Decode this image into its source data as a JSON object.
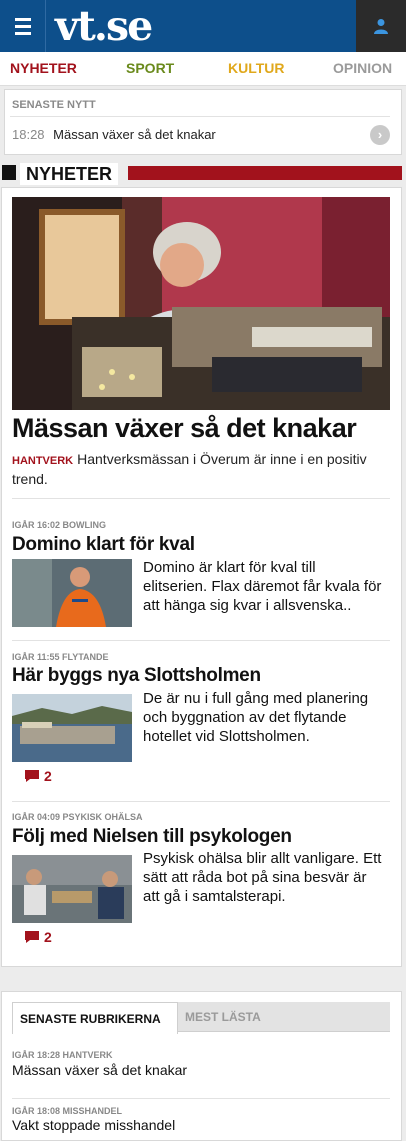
{
  "header": {
    "logo": "vt.se",
    "menu_icon": "hamburger-icon",
    "user_icon": "user-icon",
    "brand_color": "#0d4f8b"
  },
  "nav": {
    "items": [
      {
        "label": "NYHETER",
        "color": "#a2121c"
      },
      {
        "label": "SPORT",
        "color": "#6a8a1c"
      },
      {
        "label": "KULTUR",
        "color": "#e0a81c"
      },
      {
        "label": "OPINION",
        "color": "#9a9a9a"
      }
    ]
  },
  "senaste": {
    "title": "SENASTE NYTT",
    "time": "18:28",
    "text": "Mässan växer så det knakar",
    "arrow": "›"
  },
  "section": {
    "label": "NYHETER",
    "accent": "#a2121c"
  },
  "hero": {
    "headline": "Mässan växer så det knakar",
    "tag": "HANTVERK",
    "lead": "Hantverksmässan i Överum är inne i en positiv trend."
  },
  "articles": [
    {
      "meta": "IGÅR 16:02 BOWLING",
      "title": "Domino klart för kval",
      "text": "Domino är klart för kval till elitserien. Flax däremot får kvala för att hänga sig kvar i allsvenska..",
      "comments": ""
    },
    {
      "meta": "IGÅR 11:55 FLYTANDE",
      "title": "Här byggs nya Slottsholmen",
      "text": "De är nu i full gång med planering och byggnation av det flytande hotellet vid Slottsholmen.",
      "comments": "2"
    },
    {
      "meta": "IGÅR 04:09 PSYKISK OHÄLSA",
      "title": "Följ med Nielsen till psykologen",
      "text": "Psykisk ohälsa blir allt vanligare. Ett sätt att råda bot på sina besvär är att gå i samtalsterapi.",
      "comments": "2"
    }
  ],
  "tabs": {
    "active": "SENASTE RUBRIKERNA",
    "inactive": "MEST LÄSTA"
  },
  "latest_list": [
    {
      "meta": "IGÅR 18:28 HANTVERK",
      "title": "Mässan växer så det knakar"
    },
    {
      "meta": "IGÅR 18:08 MISSHANDEL",
      "title": "Vakt stoppade misshandel"
    }
  ]
}
